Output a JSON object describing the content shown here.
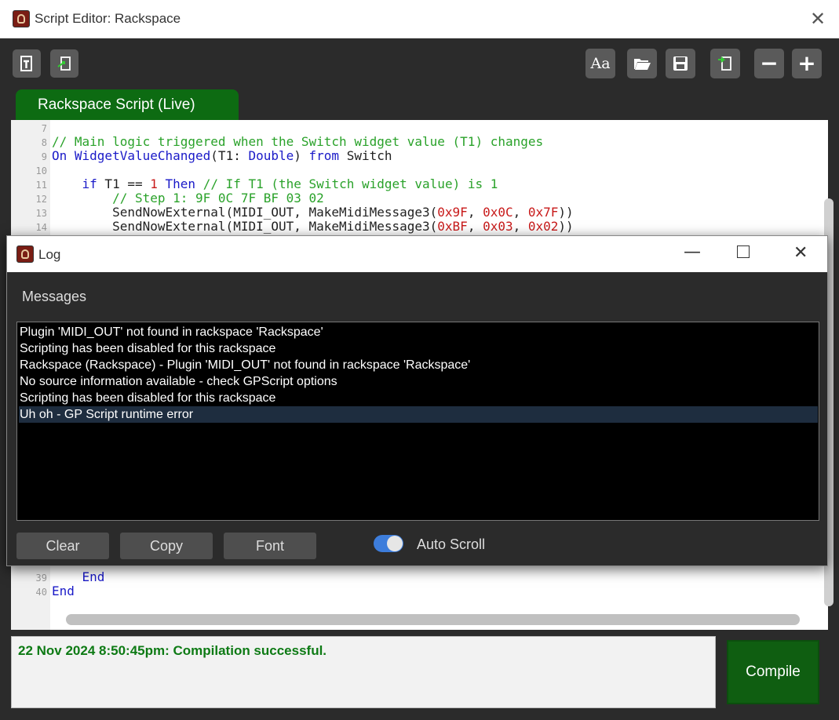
{
  "window": {
    "title": "Script Editor:  Rackspace"
  },
  "toolbar": {
    "left_buttons": [
      {
        "name": "template-icon"
      },
      {
        "name": "import-icon"
      }
    ],
    "right_buttons": [
      {
        "name": "font-icon",
        "label": "Aa"
      },
      {
        "name": "open-folder-icon"
      },
      {
        "name": "save-icon"
      },
      {
        "name": "export-icon"
      },
      {
        "name": "zoom-out-icon",
        "label": "−"
      },
      {
        "name": "zoom-in-icon",
        "label": "+"
      }
    ]
  },
  "tab": {
    "label": "Rackspace Script (Live)"
  },
  "code": {
    "top_lines": [
      {
        "num": "7",
        "parts": []
      },
      {
        "num": "8",
        "parts": [
          {
            "t": "cm",
            "s": "// Main logic triggered when the Switch widget value (T1) changes"
          }
        ]
      },
      {
        "num": "9",
        "parts": [
          {
            "t": "kw",
            "s": "On WidgetValueChanged"
          },
          {
            "t": "tx",
            "s": "(T1: "
          },
          {
            "t": "kw",
            "s": "Double"
          },
          {
            "t": "tx",
            "s": ") "
          },
          {
            "t": "kw",
            "s": "from"
          },
          {
            "t": "tx",
            "s": " Switch"
          }
        ]
      },
      {
        "num": "10",
        "parts": []
      },
      {
        "num": "11",
        "parts": [
          {
            "t": "tx",
            "s": "    "
          },
          {
            "t": "kw",
            "s": "if"
          },
          {
            "t": "tx",
            "s": " T1 == "
          },
          {
            "t": "nm",
            "s": "1"
          },
          {
            "t": "tx",
            "s": " "
          },
          {
            "t": "kw",
            "s": "Then"
          },
          {
            "t": "tx",
            "s": " "
          },
          {
            "t": "cm",
            "s": "// If T1 (the Switch widget value) is 1"
          }
        ]
      },
      {
        "num": "12",
        "parts": [
          {
            "t": "tx",
            "s": "        "
          },
          {
            "t": "cm",
            "s": "// Step 1: 9F 0C 7F BF 03 02"
          }
        ]
      },
      {
        "num": "13",
        "parts": [
          {
            "t": "tx",
            "s": "        SendNowExternal(MIDI_OUT, MakeMidiMessage3("
          },
          {
            "t": "nm",
            "s": "0x9F"
          },
          {
            "t": "tx",
            "s": ", "
          },
          {
            "t": "nm",
            "s": "0x0C"
          },
          {
            "t": "tx",
            "s": ", "
          },
          {
            "t": "nm",
            "s": "0x7F"
          },
          {
            "t": "tx",
            "s": "))"
          }
        ]
      },
      {
        "num": "14",
        "parts": [
          {
            "t": "tx",
            "s": "        SendNowExternal(MIDI_OUT, MakeMidiMessage3("
          },
          {
            "t": "nm",
            "s": "0xBF"
          },
          {
            "t": "tx",
            "s": ", "
          },
          {
            "t": "nm",
            "s": "0x03"
          },
          {
            "t": "tx",
            "s": ", "
          },
          {
            "t": "nm",
            "s": "0x02"
          },
          {
            "t": "tx",
            "s": "))"
          }
        ]
      }
    ],
    "bottom_lines": [
      {
        "num": "39",
        "parts": [
          {
            "t": "tx",
            "s": "    "
          },
          {
            "t": "kw",
            "s": "End"
          }
        ]
      },
      {
        "num": "40",
        "parts": [
          {
            "t": "kw",
            "s": "End"
          }
        ]
      }
    ]
  },
  "log": {
    "title": "Log",
    "section": "Messages",
    "messages": [
      "Plugin 'MIDI_OUT' not found in rackspace 'Rackspace'",
      "Scripting has been disabled for this rackspace",
      "Rackspace (Rackspace) - Plugin 'MIDI_OUT' not found in rackspace 'Rackspace'",
      "No source information available - check GPScript options",
      "Scripting has been disabled for this rackspace",
      "Uh oh - GP Script runtime error"
    ],
    "selected_index": 5,
    "buttons": {
      "clear": "Clear",
      "copy": "Copy",
      "font": "Font"
    },
    "auto_scroll": {
      "label": "Auto Scroll",
      "on": true
    }
  },
  "status": {
    "message": "22 Nov 2024 8:50:45pm: Compilation successful."
  },
  "compile_label": "Compile"
}
